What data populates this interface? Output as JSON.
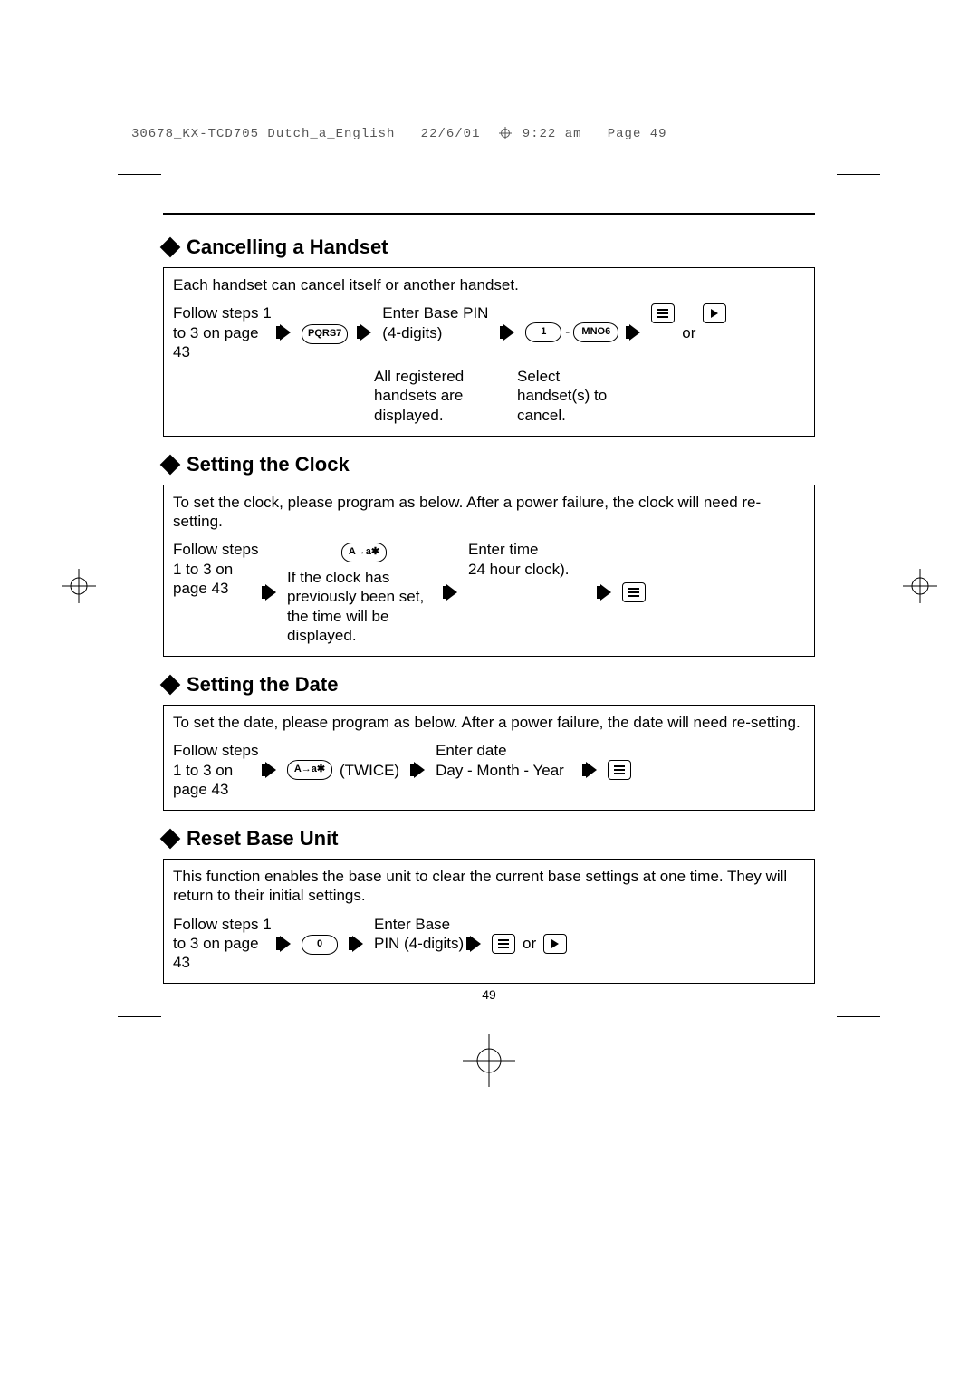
{
  "slug": {
    "file": "30678_KX-TCD705 Dutch_a_English",
    "date": "22/6/01",
    "time": "9:22 am",
    "page_label": "Page 49"
  },
  "page_number": "49",
  "sections": [
    {
      "title": "Cancelling a Handset",
      "intro": "Each handset can cancel itself or another handset.",
      "flow": {
        "step1": "Follow steps 1 to 3 on page 43",
        "key1": "PQRS7",
        "step2a": "Enter Base PIN (4-digits)",
        "step2b": "All registered handsets are displayed.",
        "keys2": [
          "1",
          "MNO6"
        ],
        "step3": "Select handset(s) to cancel.",
        "or": "or"
      }
    },
    {
      "title": "Setting the Clock",
      "intro": "To set the clock, please program as below. After a power failure, the clock will need re-setting.",
      "flow": {
        "step1": "Follow steps 1 to 3 on page 43",
        "key1": "A→a✱",
        "step1b": "If the clock has previously been set, the time will be displayed.",
        "step2a": "Enter time",
        "step2b": "24 hour clock)."
      }
    },
    {
      "title": "Setting the Date",
      "intro": "To set the date, please program as below. After a power failure, the date will need re-setting.",
      "flow": {
        "step1": "Follow steps 1 to 3 on page 43",
        "key1": "A→a✱",
        "key1_suffix": "(TWICE)",
        "step2a": "Enter date",
        "step2b": "Day - Month - Year"
      }
    },
    {
      "title": "Reset Base Unit",
      "intro": "This function enables the base unit to clear the current base settings at one time. They will return to their initial settings.",
      "flow": {
        "step1": "Follow steps 1 to 3 on page 43",
        "key1": "0",
        "step2a": "Enter Base PIN (4-digits)",
        "or": "or"
      }
    }
  ]
}
